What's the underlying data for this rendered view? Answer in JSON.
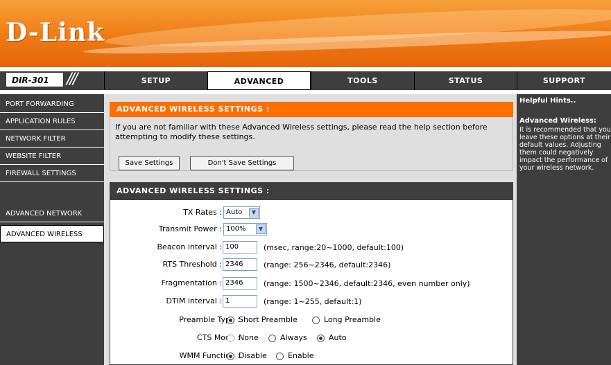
{
  "brand": {
    "logo_text": "D-Link",
    "model": "DIR-301",
    "slashes": "///"
  },
  "colors": {
    "accent": "#ff6f00",
    "nav_bg": "#3e3e3e",
    "panel_bg": "#dfdfdf"
  },
  "top_tabs": [
    "SETUP",
    "ADVANCED",
    "TOOLS",
    "STATUS",
    "SUPPORT"
  ],
  "active_tab": "ADVANCED",
  "left_nav": [
    "PORT FORWARDING",
    "APPLICATION RULES",
    "NETWORK FILTER",
    "WEBSITE FILTER",
    "FIREWALL SETTINGS",
    "ADVANCED WIRELESS",
    "ADVANCED NETWORK"
  ],
  "active_left": "ADVANCED WIRELESS",
  "hints": {
    "title": "Helpful Hints..",
    "heading": "Advanced Wireless:",
    "text": "It is recommended that you leave these options at their default values. Adjusting them could negatively impact the performance of your wireless network."
  },
  "intro": {
    "header": "ADVANCED WIRELESS SETTINGS :",
    "text": "If you are not familiar with these Advanced Wireless settings, please read the help section before attempting to modify these settings.",
    "save_label": "Save Settings",
    "dont_save_label": "Don't Save Settings"
  },
  "settings": {
    "header": "ADVANCED WIRELESS SETTINGS :",
    "tx_rates": {
      "label": "TX Rates :",
      "value": "Auto"
    },
    "transmit_power": {
      "label": "Transmit Power :",
      "value": "100%"
    },
    "beacon": {
      "label": "Beacon interval :",
      "value": "100",
      "hint": "(msec, range:20~1000, default:100)"
    },
    "rts": {
      "label": "RTS Threshold :",
      "value": "2346",
      "hint": "(range: 256~2346, default:2346)"
    },
    "frag": {
      "label": "Fragmentation :",
      "value": "2346",
      "hint": "(range: 1500~2346, default:2346, even number only)"
    },
    "dtim": {
      "label": "DTIM interval :",
      "value": "1",
      "hint": "(range: 1~255, default:1)"
    },
    "preamble": {
      "label": "Preamble Type :",
      "options": [
        "Short Preamble",
        "Long Preamble"
      ],
      "selected": "Short Preamble"
    },
    "cts": {
      "label": "CTS Mode :",
      "options": [
        "None",
        "Always",
        "Auto"
      ],
      "selected": "Auto"
    },
    "wmm": {
      "label": "WMM Function :",
      "options": [
        "Disable",
        "Enable"
      ],
      "selected": "Disable"
    }
  },
  "icons": {
    "dropdown": "chevron-down-icon"
  }
}
